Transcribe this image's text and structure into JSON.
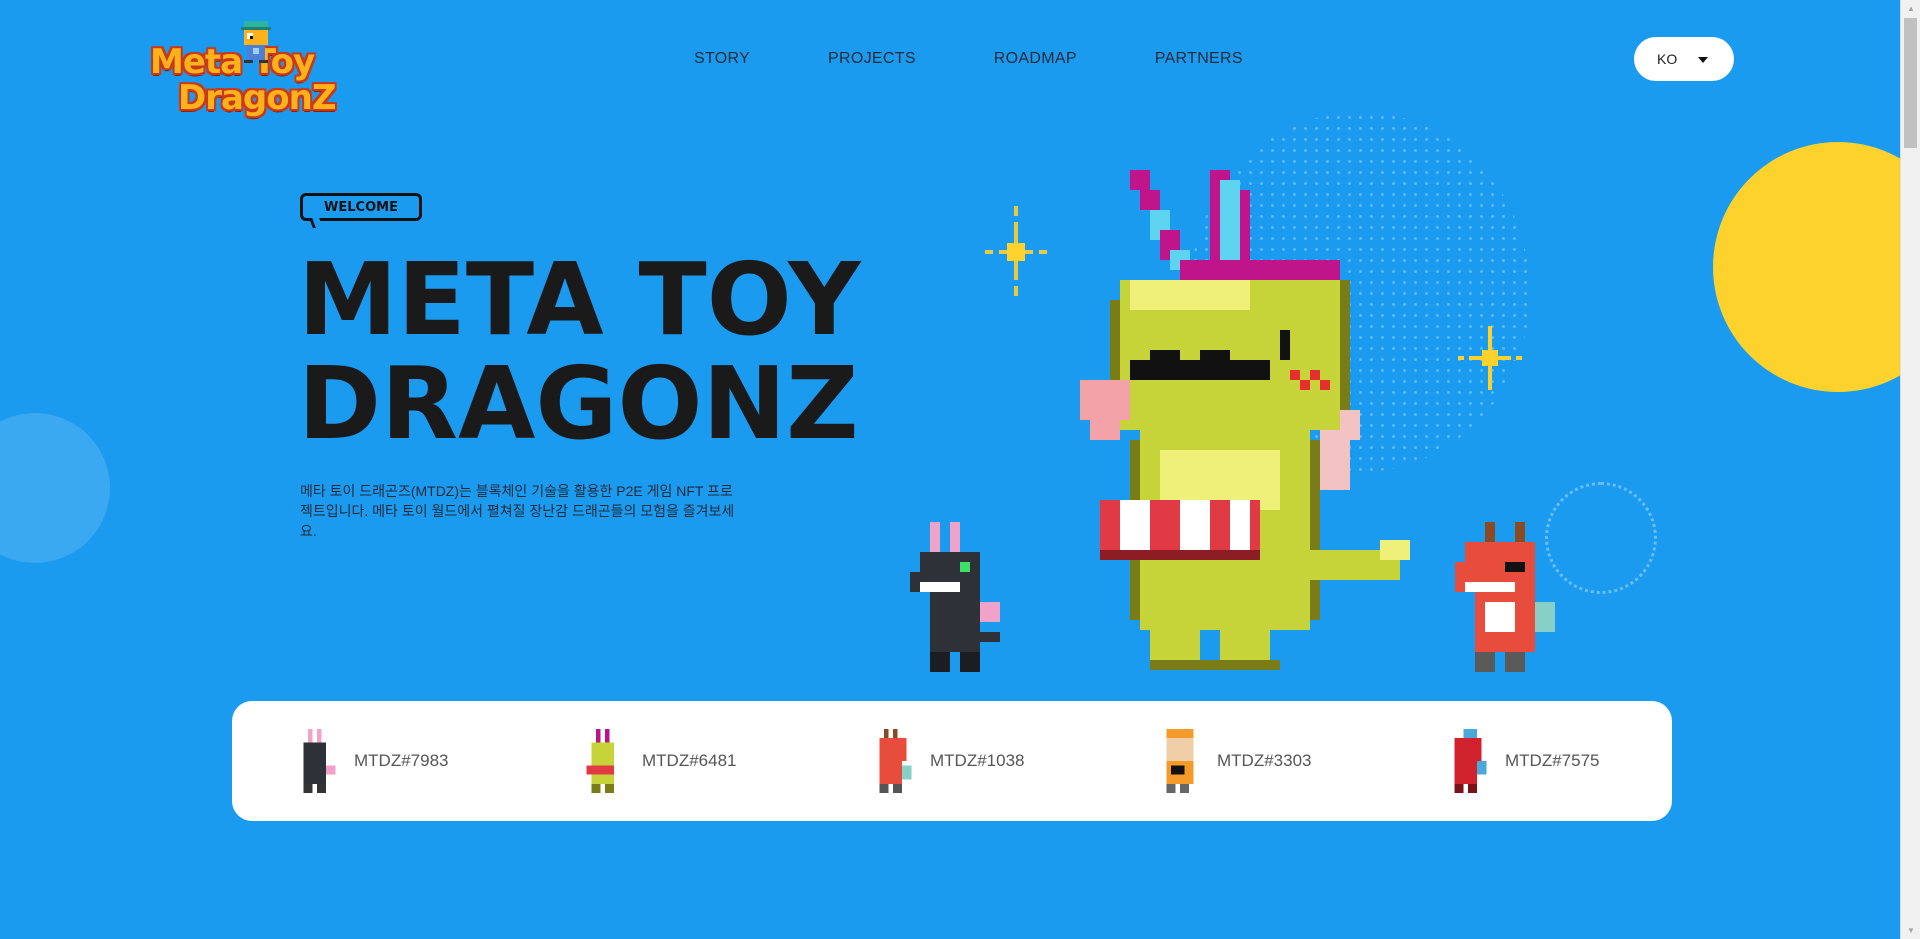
{
  "brand": {
    "logo_line1": "Meta Toy",
    "logo_line2": "DragonZ"
  },
  "nav": {
    "items": [
      "STORY",
      "PROJECTS",
      "ROADMAP",
      "PARTNERS"
    ]
  },
  "language": {
    "selected": "KO"
  },
  "hero": {
    "badge": "WELCOME",
    "title_line1": "META TOY",
    "title_line2": "DRAGONZ",
    "description": "메타 토이 드래곤즈(MTDZ)는 블록체인 기술을 활용한 P2E 게임 NFT 프로젝트입니다. 메타 토이 월드에서 펼쳐질 장난감 드래곤들의 모험을 즐겨보세요."
  },
  "nfts": [
    {
      "label": "MTDZ#7983",
      "body_color": "#2e3138",
      "accent": "#f0a3c8"
    },
    {
      "label": "MTDZ#6481",
      "body_color": "#c6d43a",
      "accent": "#b9148c"
    },
    {
      "label": "MTDZ#1038",
      "body_color": "#e74c3c",
      "accent": "#86d0c8"
    },
    {
      "label": "MTDZ#3303",
      "body_color": "#f0cfa8",
      "accent": "#f59b2a"
    },
    {
      "label": "MTDZ#7575",
      "body_color": "#d0212c",
      "accent": "#4aa9d8"
    }
  ],
  "colors": {
    "background": "#1a9bf0",
    "yellow": "#fdd22c",
    "title": "#1a1a1a"
  }
}
